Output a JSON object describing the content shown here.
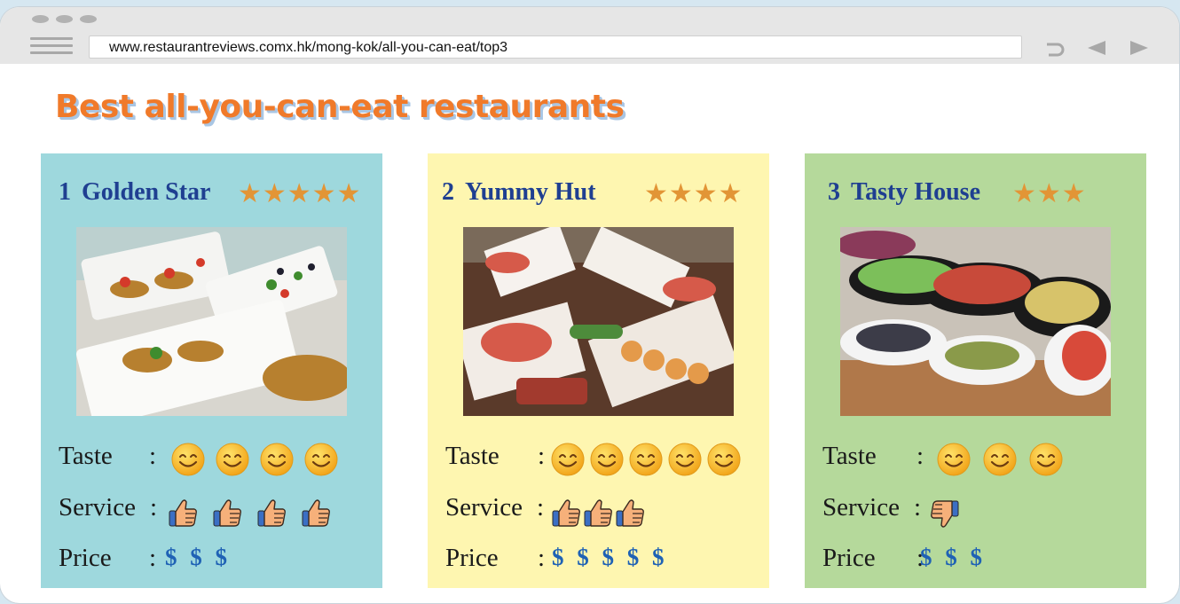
{
  "browser": {
    "url": "www.restaurantreviews.comx.hk/mong-kok/all-you-can-eat/top3"
  },
  "page": {
    "title": "Best all-you-can-eat restaurants"
  },
  "restaurants": [
    {
      "rank": "1",
      "name": "Golden Star",
      "stars_text": "★★★★★",
      "stars": 5,
      "taste_label": "Taste",
      "taste": 4,
      "service_label": "Service",
      "service": 4,
      "service_thumb": "thumbs-up",
      "price_label": "Price",
      "price": "$ $ $",
      "card_color": "#9ed8dd"
    },
    {
      "rank": "2",
      "name": "Yummy Hut",
      "stars_text": "★★★★",
      "stars": 4,
      "taste_label": "Taste",
      "taste": 5,
      "service_label": "Service",
      "service": 3,
      "service_thumb": "thumbs-up",
      "price_label": "Price",
      "price": "$ $ $ $ $",
      "card_color": "#fef6b0"
    },
    {
      "rank": "3",
      "name": "Tasty House",
      "stars_text": "★★★",
      "stars": 3,
      "taste_label": "Taste",
      "taste": 3,
      "service_label": "Service",
      "service": 1,
      "service_thumb": "thumbs-down",
      "price_label": "Price",
      "price": "$ $ $",
      "card_color": "#b5d99b"
    }
  ],
  "colors": {
    "title": "#f07a2a",
    "name": "#1f3f91",
    "star": "#e29536",
    "price": "#1f62b5"
  }
}
